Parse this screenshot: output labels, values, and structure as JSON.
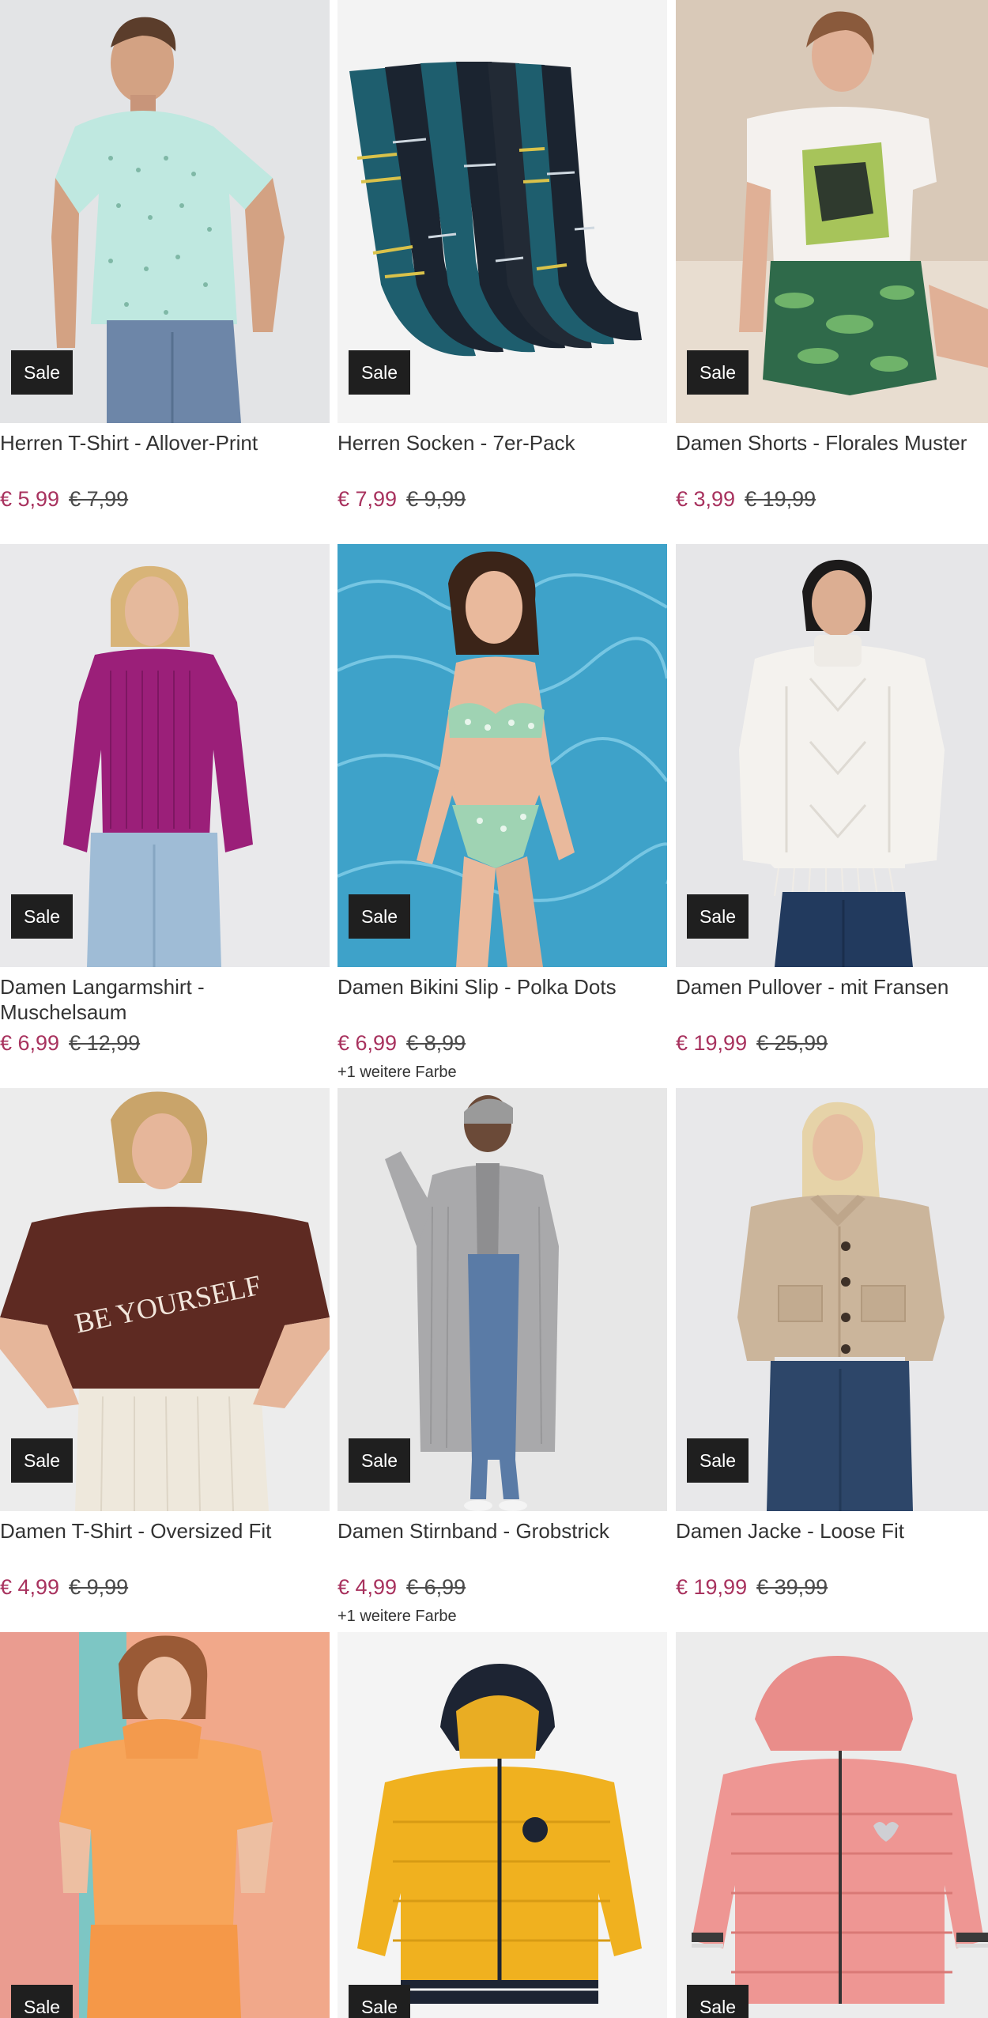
{
  "products": [
    {
      "title": "Herren T-Shirt - Allover-Print",
      "price": "€ 5,99",
      "old_price": "€ 7,99",
      "badge": "Sale",
      "extra": "",
      "image": "man-mint-tshirt"
    },
    {
      "title": "Herren Socken - 7er-Pack",
      "price": "€ 7,99",
      "old_price": "€ 9,99",
      "badge": "Sale",
      "extra": "",
      "image": "striped-socks"
    },
    {
      "title": "Damen Shorts - Florales Muster",
      "price": "€ 3,99",
      "old_price": "€ 19,99",
      "badge": "Sale",
      "extra": "",
      "image": "woman-floral-shorts"
    },
    {
      "title": "Damen Langarmshirt - Muschelsaum",
      "price": "€ 6,99",
      "old_price": "€ 12,99",
      "badge": "Sale",
      "extra": "",
      "image": "woman-purple-longsleeve"
    },
    {
      "title": "Damen Bikini Slip - Polka Dots",
      "price": "€ 6,99",
      "old_price": "€ 8,99",
      "badge": "Sale",
      "extra": "+1 weitere Farbe",
      "image": "woman-bikini-pool"
    },
    {
      "title": "Damen Pullover - mit Fransen",
      "price": "€ 19,99",
      "old_price": "€ 25,99",
      "badge": "Sale",
      "extra": "",
      "image": "woman-white-sweater"
    },
    {
      "title": "Damen T-Shirt - Oversized Fit",
      "price": "€ 4,99",
      "old_price": "€ 9,99",
      "badge": "Sale",
      "extra": "",
      "image": "woman-brown-tshirt"
    },
    {
      "title": "Damen Stirnband - Grobstrick",
      "price": "€ 4,99",
      "old_price": "€ 6,99",
      "badge": "Sale",
      "extra": "+1 weitere Farbe",
      "image": "woman-grey-cardigan"
    },
    {
      "title": "Damen Jacke - Loose Fit",
      "price": "€ 19,99",
      "old_price": "€ 39,99",
      "badge": "Sale",
      "extra": "",
      "image": "woman-beige-jacket"
    },
    {
      "title": "",
      "price": "",
      "old_price": "",
      "badge": "Sale",
      "extra": "",
      "image": "girl-orange-hoodie"
    },
    {
      "title": "",
      "price": "",
      "old_price": "",
      "badge": "Sale",
      "extra": "",
      "image": "yellow-kids-jacket"
    },
    {
      "title": "",
      "price": "",
      "old_price": "",
      "badge": "Sale",
      "extra": "",
      "image": "pink-kids-jacket"
    }
  ],
  "image_texts": {
    "tshirt_print": "BE YOURSELF"
  },
  "colors": {
    "price_accent": "#a8325e",
    "badge_bg": "#1f1f1f",
    "badge_text": "#ffffff"
  }
}
